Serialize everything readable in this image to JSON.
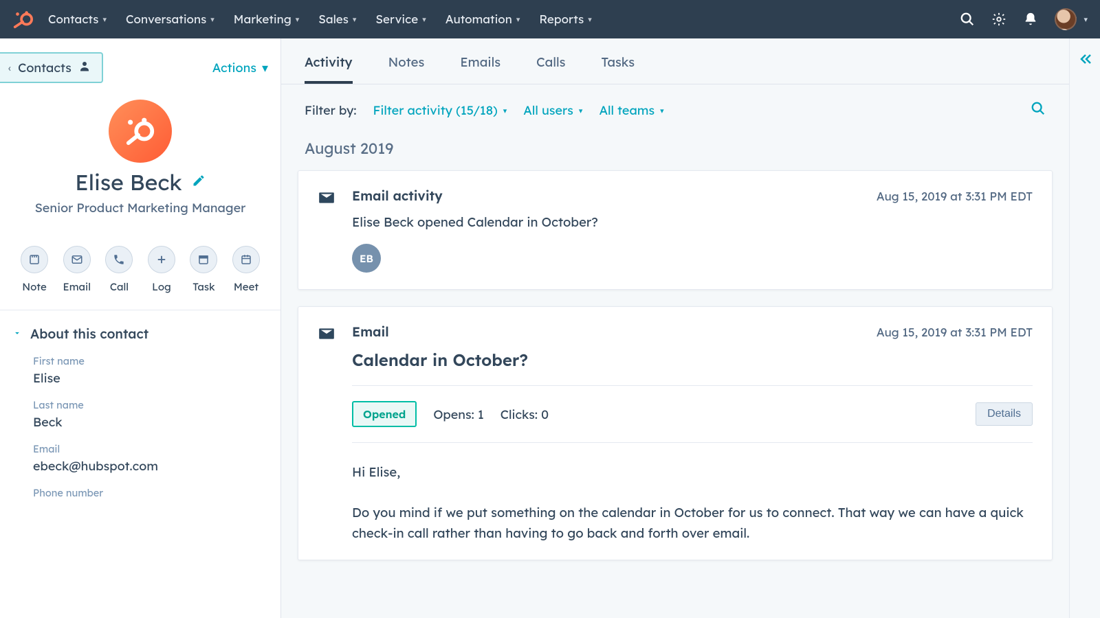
{
  "nav": {
    "items": [
      "Contacts",
      "Conversations",
      "Marketing",
      "Sales",
      "Service",
      "Automation",
      "Reports"
    ]
  },
  "left": {
    "back_label": "Contacts",
    "actions_label": "Actions",
    "contact": {
      "name": "Elise Beck",
      "title": "Senior Product Marketing Manager",
      "initials": "EB"
    },
    "action_buttons": [
      {
        "key": "note",
        "label": "Note"
      },
      {
        "key": "email",
        "label": "Email"
      },
      {
        "key": "call",
        "label": "Call"
      },
      {
        "key": "log",
        "label": "Log"
      },
      {
        "key": "task",
        "label": "Task"
      },
      {
        "key": "meet",
        "label": "Meet"
      }
    ],
    "about": {
      "section_title": "About this contact",
      "fields": [
        {
          "label": "First name",
          "value": "Elise"
        },
        {
          "label": "Last name",
          "value": "Beck"
        },
        {
          "label": "Email",
          "value": "ebeck@hubspot.com"
        },
        {
          "label": "Phone number",
          "value": ""
        }
      ]
    }
  },
  "tabs": [
    "Activity",
    "Notes",
    "Emails",
    "Calls",
    "Tasks"
  ],
  "active_tab": "Activity",
  "filters": {
    "label": "Filter by:",
    "activity": "Filter activity (15/18)",
    "users": "All users",
    "teams": "All teams"
  },
  "timeline": {
    "group": "August 2019",
    "items": [
      {
        "type": "email_activity",
        "title": "Email activity",
        "date": "Aug 15, 2019 at 3:31 PM EDT",
        "text": "Elise Beck opened Calendar in October?",
        "avatar_initials": "EB"
      },
      {
        "type": "email",
        "title": "Email",
        "date": "Aug 15, 2019 at 3:31 PM EDT",
        "subject": "Calendar in October?",
        "status_badge": "Opened",
        "opens_label": "Opens:",
        "opens_value": "1",
        "clicks_label": "Clicks:",
        "clicks_value": "0",
        "details_label": "Details",
        "body_greeting": "Hi Elise,",
        "body_text": "Do you mind if we put something on the calendar in October for us to connect. That way we can have a quick check-in call rather than having to go back and forth over email."
      }
    ]
  }
}
